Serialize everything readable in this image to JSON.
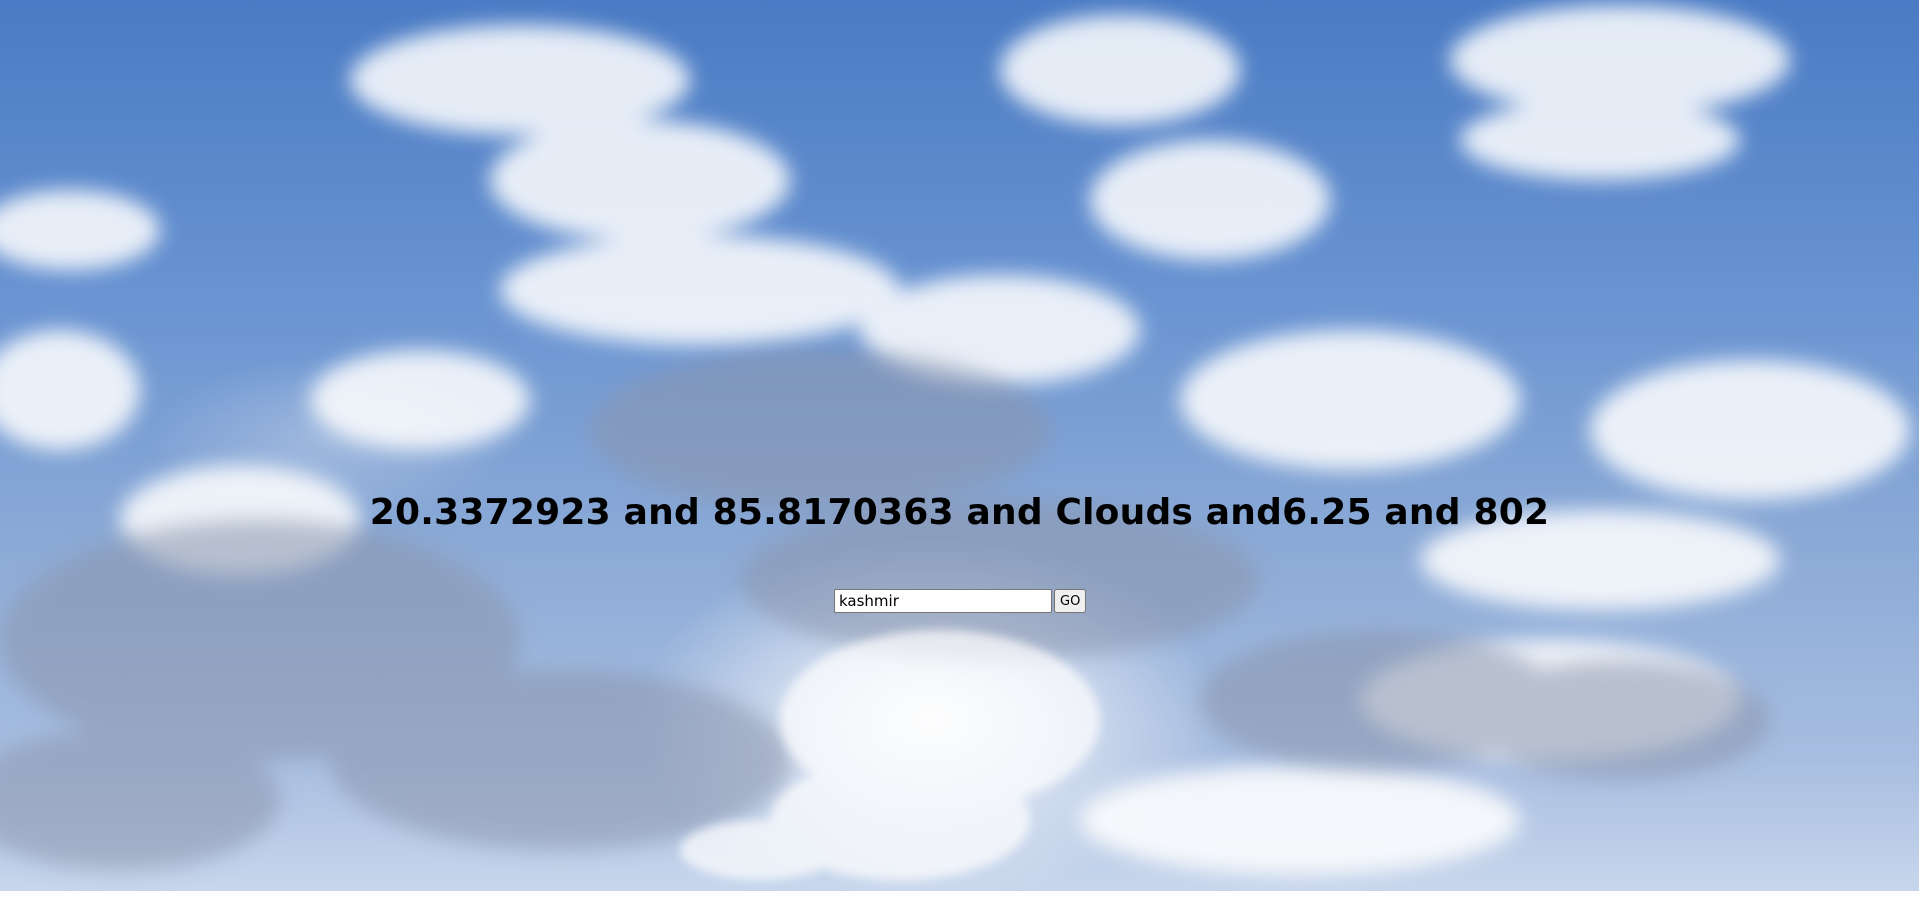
{
  "weather": {
    "summary": "20.3372923 and 85.8170363 and Clouds and6.25 and 802"
  },
  "search": {
    "value": "kashmir",
    "button_label": "GO"
  }
}
